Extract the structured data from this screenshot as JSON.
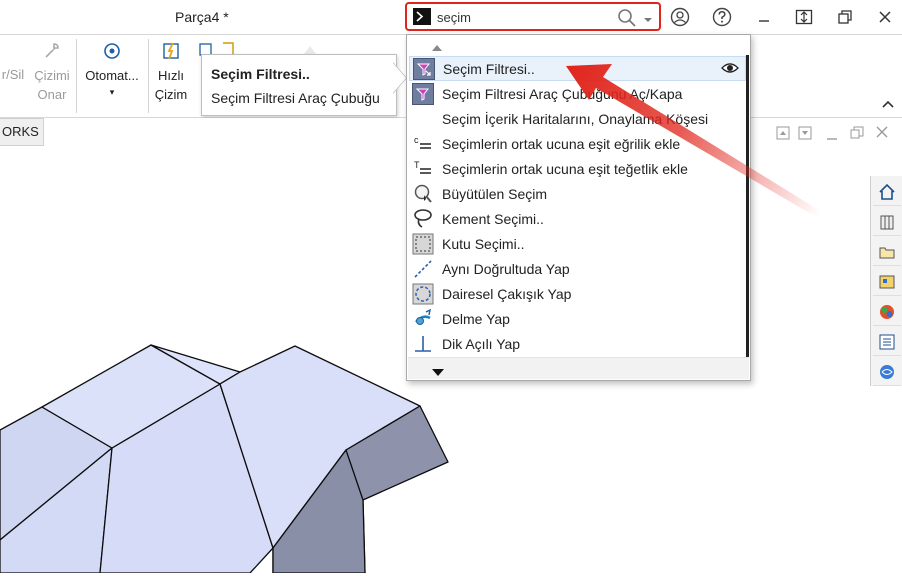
{
  "window": {
    "title": "Parça4 *"
  },
  "search": {
    "value": "seçim"
  },
  "ribbon": {
    "items": [
      {
        "label": "r/Sil"
      },
      {
        "label": "Çizimi"
      },
      {
        "label": "Onar"
      },
      {
        "label": "Otomat..."
      },
      {
        "label": "Hızlı"
      },
      {
        "label": "Çizim"
      }
    ]
  },
  "tooltip": {
    "title": "Seçim Filtresi..",
    "description": "Seçim Filtresi Araç Çubuğu"
  },
  "tab": {
    "label": "ORKS"
  },
  "menu": {
    "items": [
      {
        "label": "Seçim Filtresi..",
        "icon": "funnel-icon"
      },
      {
        "label": "Seçim Filtresi Araç Çubuğunu Aç/Kapa",
        "icon": "funnel-icon"
      },
      {
        "label": "Seçim İçerik Haritalarını, Onaylama Köşesi",
        "icon": ""
      },
      {
        "label": "Seçimlerin ortak ucuna eşit eğrilik ekle",
        "icon": "curvature-relation-icon"
      },
      {
        "label": "Seçimlerin ortak ucuna eşit teğetlik ekle",
        "icon": "tangency-relation-icon"
      },
      {
        "label": "Büyütülen Seçim",
        "icon": "magnified-selection-icon"
      },
      {
        "label": "Kement Seçimi..",
        "icon": "lasso-icon"
      },
      {
        "label": "Kutu Seçimi..",
        "icon": "box-select-icon"
      },
      {
        "label": "Aynı Doğrultuda Yap",
        "icon": "collinear-icon"
      },
      {
        "label": "Dairesel Çakışık Yap",
        "icon": "coradial-icon"
      },
      {
        "label": "Delme Yap",
        "icon": "pierce-icon"
      },
      {
        "label": "Dik Açılı Yap",
        "icon": "perpendicular-icon"
      }
    ]
  },
  "colors": {
    "highlight": "#e0241b",
    "model_face": "#dbe1f9",
    "model_side": "#8f93aa"
  }
}
